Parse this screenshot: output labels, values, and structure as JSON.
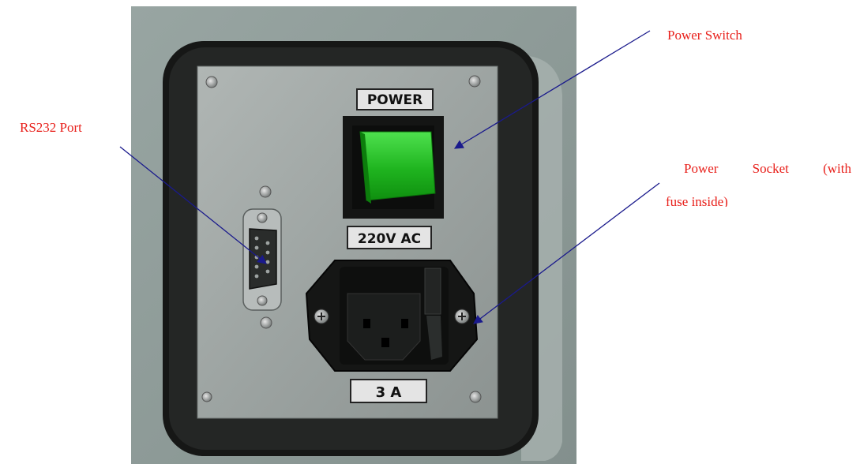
{
  "panel": {
    "power_label": "POWER",
    "voltage_label": "220V AC",
    "fuse_label": "3 A"
  },
  "callouts": {
    "rs232": "RS232 Port",
    "power_switch": "Power Switch",
    "power_socket_line1": "Power Socket (with",
    "power_socket_line2": "fuse inside)"
  },
  "colors": {
    "callout_text": "#e8201b",
    "arrow": "#1a1a8c",
    "switch_green": "#22b322",
    "housing": "#8f9c99",
    "plate": "#9fa6a4"
  }
}
